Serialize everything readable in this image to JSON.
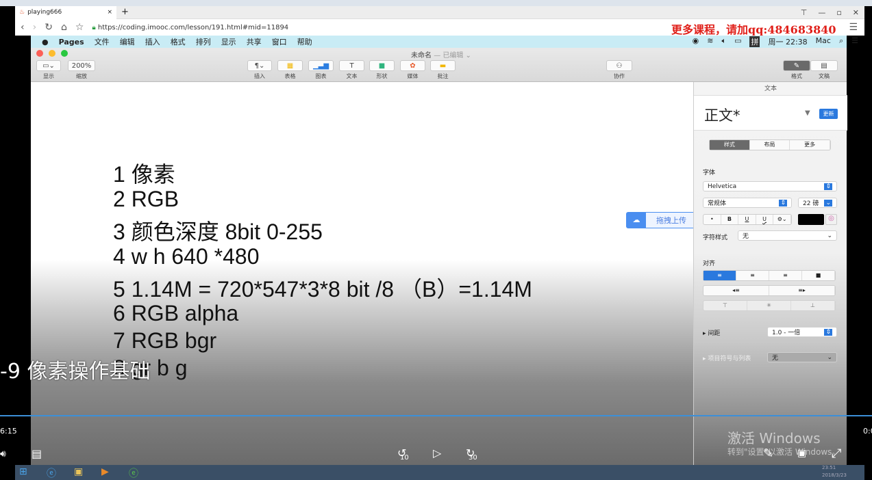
{
  "browser": {
    "tab_title": "playing666",
    "url": "https://coding.imooc.com/lesson/191.html#mid=11894",
    "promo": "更多课程，请加qq:484683840"
  },
  "menubar": {
    "apple": "",
    "app": "Pages",
    "items": [
      "文件",
      "编辑",
      "插入",
      "格式",
      "排列",
      "显示",
      "共享",
      "窗口",
      "帮助"
    ],
    "clock": "周一 22:38",
    "user": "Mac",
    "ime": "拼"
  },
  "window": {
    "title": "未命名",
    "status": "— 已编辑 ⌄"
  },
  "toolbar": {
    "view": "显示",
    "zoom_value": "200%",
    "zoom": "缩放",
    "insert": "插入",
    "table": "表格",
    "chart": "图表",
    "text": "文本",
    "shape": "形状",
    "media": "媒体",
    "comment": "批注",
    "collab": "协作",
    "format": "格式",
    "document": "文稿"
  },
  "doc": {
    "lines": [
      "1 像素",
      "2 RGB",
      "3 颜色深度 8bit 0-255",
      "4 w h 640 *480",
      "5 1.14M = 720*547*3*8 bit /8 （B）=1.14M",
      "6 RGB alpha",
      "7 RGB bgr",
      "8 gr b g"
    ]
  },
  "upload": {
    "label": "拖拽上传"
  },
  "inspector": {
    "header": "文本",
    "style_name": "正文*",
    "update": "更新",
    "tabs": [
      "样式",
      "布局",
      "更多"
    ],
    "font_label": "字体",
    "font": "Helvetica",
    "typeface": "常规体",
    "size": "22 磅",
    "char_style_label": "字符样式",
    "char_style": "无",
    "align_label": "对齐",
    "spacing_label": "间距",
    "spacing": "1.0 - 一倍",
    "bullets_label": "项目符号与列表",
    "bullets": "无",
    "bold": "B",
    "italic": "•",
    "underline": "U",
    "strike": "U"
  },
  "video": {
    "subtitle": "-9 像素操作基础",
    "elapsed": "6:15",
    "remaining": "0:0",
    "rewind": "10",
    "forward": "30",
    "progress": 0.0
  },
  "watermark": {
    "title": "激活 Windows",
    "sub": "转到\"设置\"以激活 Windows。"
  },
  "taskbar": {
    "time": "23:51",
    "date": "2018/3/23"
  }
}
